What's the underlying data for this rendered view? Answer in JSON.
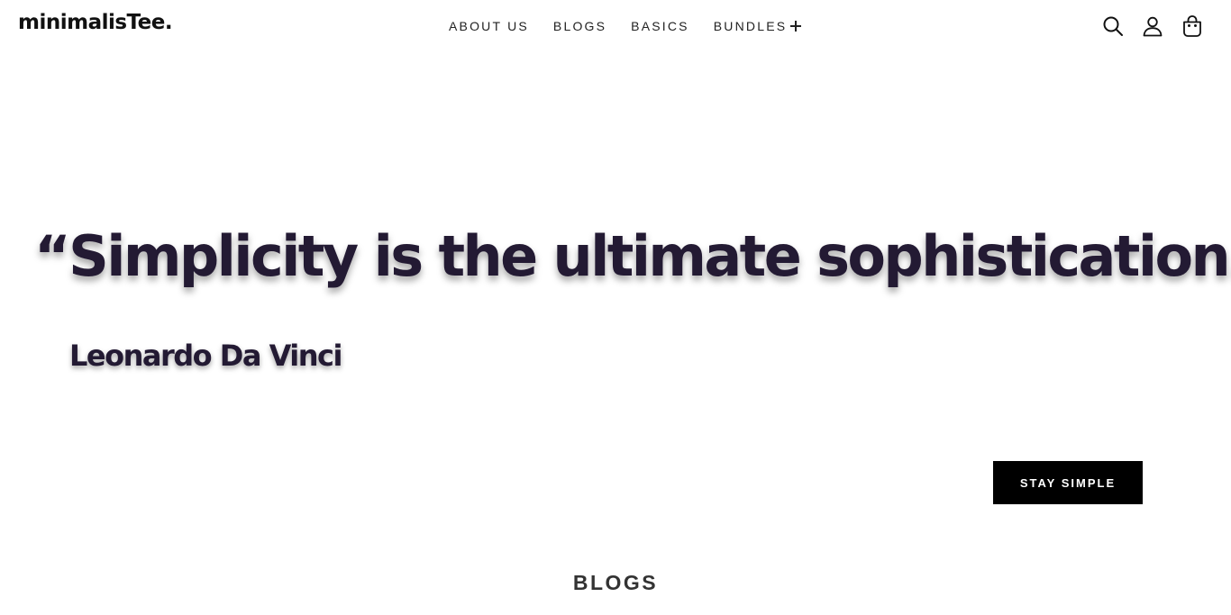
{
  "header": {
    "logo_text": "minimalisTee.",
    "nav": [
      {
        "label": "ABOUT US"
      },
      {
        "label": "BLOGS"
      },
      {
        "label": "BASICS"
      },
      {
        "label": "BUNDLES",
        "icon": "plus-icon"
      }
    ],
    "icons": [
      "search-icon",
      "account-icon",
      "cart-icon"
    ]
  },
  "hero": {
    "quote": "“Simplicity is the ultimate sophistication.”",
    "author": "Leonardo Da Vinci",
    "cta_label": "STAY SIMPLE"
  },
  "section": {
    "title": "BLOGS"
  },
  "colors": {
    "quote_text": "#231a33",
    "cta_background": "#000000",
    "cta_text": "#ffffff",
    "section_title": "#333333"
  }
}
